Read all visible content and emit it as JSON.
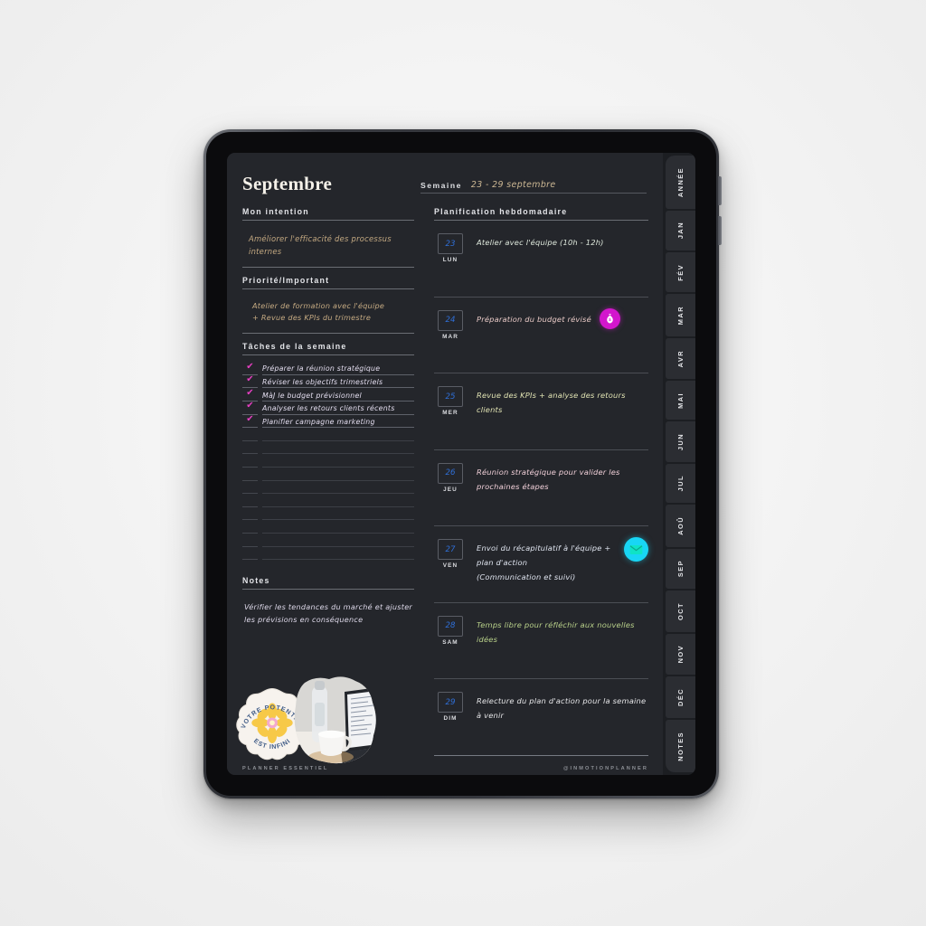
{
  "header": {
    "month": "Septembre",
    "week_label": "Semaine",
    "week_range": "23 - 29 septembre"
  },
  "left": {
    "intention": {
      "heading": "Mon intention",
      "text": "Améliorer l'efficacité des processus internes"
    },
    "priority": {
      "heading": "Priorité/Important",
      "text": "Atelier de formation avec l'équipe\n+ Revue des KPIs du trimestre"
    },
    "tasks": {
      "heading": "Tâches de la semaine",
      "checkmark": "✔",
      "items": [
        {
          "label": "Préparer la réunion stratégique",
          "checked": true
        },
        {
          "label": "Réviser les objectifs trimestriels",
          "checked": true
        },
        {
          "label": "MàJ le budget prévisionnel",
          "checked": true
        },
        {
          "label": "Analyser les retours clients récents",
          "checked": true
        },
        {
          "label": "Planifier campagne marketing",
          "checked": true
        },
        {
          "label": "",
          "checked": false
        },
        {
          "label": "",
          "checked": false
        },
        {
          "label": "",
          "checked": false
        },
        {
          "label": "",
          "checked": false
        },
        {
          "label": "",
          "checked": false
        },
        {
          "label": "",
          "checked": false
        },
        {
          "label": "",
          "checked": false
        },
        {
          "label": "",
          "checked": false
        },
        {
          "label": "",
          "checked": false
        },
        {
          "label": "",
          "checked": false
        }
      ]
    },
    "notes": {
      "heading": "Notes",
      "text": "Vérifier les tendances du marché et ajuster les prévisions en conséquence"
    },
    "sticker": {
      "text_top": "VOTRE POTENTIEL",
      "text_bottom": "EST INFINI"
    },
    "footer": "PLANNER ESSENTIEL"
  },
  "right": {
    "heading": "Planification hebdomadaire",
    "days": [
      {
        "num": "23",
        "name": "LUN",
        "text": "Atelier avec l'équipe (10h - 12h)",
        "color": "#dfe9dd",
        "badge": null
      },
      {
        "num": "24",
        "name": "MAR",
        "text": "Préparation du budget révisé",
        "color": "#e8c9c6",
        "badge": "money-bag-icon"
      },
      {
        "num": "25",
        "name": "MER",
        "text": "Revue des KPIs + analyse des retours clients",
        "color": "#e2e4b4",
        "badge": null
      },
      {
        "num": "26",
        "name": "JEU",
        "text": "Réunion stratégique pour valider les prochaines étapes",
        "color": "#f0cfd8",
        "badge": null
      },
      {
        "num": "27",
        "name": "VEN",
        "text": "Envoi du récapitulatif à l'équipe + plan d'action\n(Communication et suivi)",
        "color": "#dfe4ef",
        "badge": "mail-icon"
      },
      {
        "num": "28",
        "name": "SAM",
        "text": "Temps libre pour réfléchir aux nouvelles idées",
        "color": "#b9d18a",
        "badge": null
      },
      {
        "num": "29",
        "name": "DIM",
        "text": "Relecture du plan d'action pour la semaine à venir",
        "color": "#e6e6e8",
        "badge": null
      }
    ],
    "footer": "@INMOTIONPLANNER"
  },
  "rail": {
    "tabs": [
      "ANNÉE",
      "JAN",
      "FÉV",
      "MAR",
      "AVR",
      "MAI",
      "JUN",
      "JUL",
      "AOÛ",
      "SEP",
      "OCT",
      "NOV",
      "DÉC",
      "NOTES"
    ]
  },
  "colors": {
    "screen_bg": "#24262b",
    "accent_gold": "#c6ab83",
    "accent_magenta": "#e43fc0",
    "accent_cyan": "#18d6f5",
    "day_number_blue": "#2f6fd8"
  }
}
